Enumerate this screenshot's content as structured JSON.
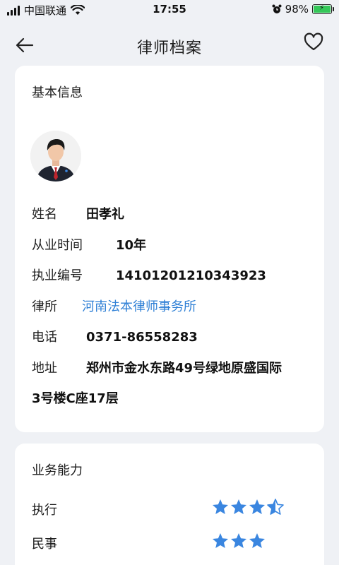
{
  "status_bar": {
    "carrier": "中国联通",
    "time": "17:55",
    "battery_percent": "98%"
  },
  "nav": {
    "title": "律师档案",
    "back_icon": "arrow-left-icon",
    "favorite_icon": "heart-outline-icon"
  },
  "basic_info": {
    "section_title": "基本信息",
    "avatar_icon": "lawyer-avatar",
    "name_label": "姓名",
    "name_value": "田孝礼",
    "years_label": "从业时间",
    "years_value": "10年",
    "license_label": "执业编号",
    "license_value": "14101201210343923",
    "firm_label": "律所",
    "firm_value": "河南法本律师事务所",
    "phone_label": "电话",
    "phone_value": "0371-86558283",
    "address_label": "地址",
    "address_line1": "郑州市金水东路49号绿地原盛国际",
    "address_line2": "3号楼C座17层"
  },
  "abilities": {
    "section_title": "业务能力",
    "items": [
      {
        "label": "执行",
        "rating": 3.5
      },
      {
        "label": "民事",
        "rating": 3
      }
    ]
  },
  "colors": {
    "star": "#3a86e0",
    "link": "#2f80d6",
    "battery": "#35c759"
  }
}
